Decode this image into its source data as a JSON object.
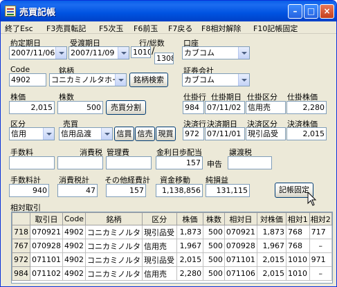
{
  "window": {
    "title": "売買記帳"
  },
  "menu": [
    "終了Esc",
    "F3売買転記",
    "F5次玉",
    "F6前玉",
    "F7戻る",
    "F8相対解除",
    "F10記帳固定"
  ],
  "form": {
    "yakujo_label": "約定期日",
    "yakujo": "2007/11/06",
    "ukewatashi_label": "受渡期日",
    "ukewatashi": "2007/11/09",
    "gyou_label": "行/総数",
    "gyou": "1010",
    "sousu": "1308",
    "kouza_label": "口座",
    "kouza": "カブコム",
    "code_label": "Code",
    "code": "4902",
    "meigara_label": "銘柄",
    "meigara": "コニカミノルタホー.",
    "meigara_search": "銘柄検索",
    "shoken_label": "証券会社",
    "shoken": "カブコム",
    "kabuka_label": "株価",
    "kabuka": "2,015",
    "kabusu_label": "株数",
    "kabusu": "500",
    "bunkatsu": "売買分割",
    "shikake_gyou_label": "仕掛行",
    "shikake_gyou": "984",
    "shikake_kijitsu_label": "仕掛期日",
    "shikake_kijitsu": "07/11/02",
    "shikake_kubun_label": "仕掛区分",
    "shikake_kubun": "信用売",
    "shikake_kabuka_label": "仕掛株価",
    "shikake_kabuka": "2,280",
    "kubun_label": "区分",
    "kubun": "信用",
    "baibai_label": "売買",
    "baibai": "信用品渡",
    "shinkai": "信買",
    "shinbai": "信売",
    "genkai": "現買",
    "kessai_gyou_label": "決済行",
    "kessai_gyou": "972",
    "kessai_kijitsu_label": "決済期日",
    "kessai_kijitsu": "07/11/01",
    "kessai_kubun_label": "決済区分",
    "kessai_kubun": "現引品受",
    "kessai_kabuka_label": "決済株価",
    "kessai_kabuka": "2,015",
    "tesuryo_label": "手数料",
    "shohizei_label": "消費税",
    "kanrihi_label": "管理費",
    "kinri_label": "金利日歩配当",
    "kinri": "157",
    "shinkoku": "申告",
    "joto_label": "譲渡税",
    "tesuryo_kei_label": "手数料計",
    "tesuryo_kei": "940",
    "shohizei_kei_label": "消費税計",
    "shohizei_kei": "47",
    "sonota_label": "その他経費計",
    "sonota": "157",
    "shikin_label": "資金移動",
    "shikin": "1,138,856",
    "junson_label": "純損益",
    "junson": "131,115",
    "kicho_kotei": "記帳固定"
  },
  "grid": {
    "caption": "相対取引",
    "headers": [
      "取引日",
      "Code",
      "銘柄",
      "区分",
      "株価",
      "株数",
      "相対日",
      "対株価",
      "相対1",
      "相対2"
    ],
    "rows": [
      {
        "id": "718",
        "vals": [
          "070921",
          "4902",
          "コニカミノルタ",
          "現引品受",
          "1,873",
          "500",
          "070921",
          "1,873",
          "768",
          "717"
        ]
      },
      {
        "id": "767",
        "vals": [
          "070928",
          "4902",
          "コニカミノルタ",
          "信用売",
          "1,967",
          "500",
          "070928",
          "1,967",
          "768",
          "–"
        ]
      },
      {
        "id": "972",
        "vals": [
          "071101",
          "4902",
          "コニカミノルタ",
          "現引品受",
          "2,015",
          "500",
          "071101",
          "2,015",
          "1010",
          "971"
        ]
      },
      {
        "id": "984",
        "vals": [
          "071102",
          "4902",
          "コニカミノルタ",
          "信用売",
          "2,280",
          "500",
          "071106",
          "2,015",
          "1010",
          "–"
        ]
      }
    ]
  },
  "colors": {
    "titlebar": "#0054e3",
    "window": "#ece9d8",
    "border": "#7f9db9"
  }
}
